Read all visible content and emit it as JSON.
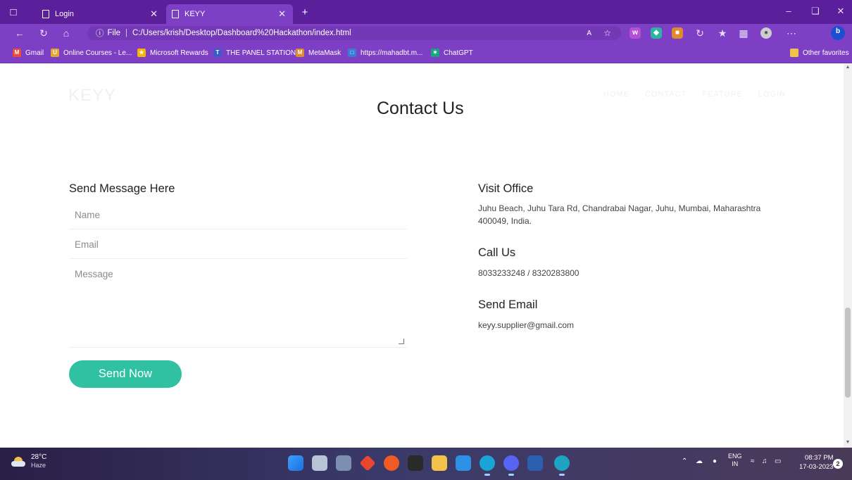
{
  "browser": {
    "tabs": [
      {
        "label": "Login"
      },
      {
        "label": "KEYY"
      }
    ],
    "new_tab_symbol": "+",
    "address": {
      "prefix": "File",
      "url": "C:/Users/krish/Desktop/Dashboard%20Hackathon/index.html"
    },
    "bookmarks": [
      {
        "label": "Gmail"
      },
      {
        "label": "Online Courses - Le..."
      },
      {
        "label": "Microsoft Rewards"
      },
      {
        "label": "THE PANEL STATION"
      },
      {
        "label": "MetaMask"
      },
      {
        "label": "https://mahadbt.m..."
      },
      {
        "label": "ChatGPT"
      }
    ],
    "other_favorites": "Other favorites",
    "accent_color": "#7d3fc4"
  },
  "page": {
    "brand": "KEYY",
    "nav": [
      "HOME",
      "CONTACT",
      "FEATURE",
      "LOGIN"
    ],
    "section_title": "Contact Us",
    "form": {
      "title": "Send Message Here",
      "name_placeholder": "Name",
      "email_placeholder": "Email",
      "message_placeholder": "Message",
      "send_label": "Send Now",
      "button_color": "#2fc1a2"
    },
    "info": {
      "office_title": "Visit Office",
      "office_address": "Juhu Beach, Juhu Tara Rd, Chandrabai Nagar, Juhu, Mumbai, Maharashtra 400049, India.",
      "call_title": "Call Us",
      "phones": "8033233248 / 8320283800",
      "email_title": "Send Email",
      "email": "keyy.supplier@gmail.com"
    }
  },
  "taskbar": {
    "temperature": "28°C",
    "weather": "Haze",
    "language": "ENG",
    "region": "IN",
    "time": "08:37 PM",
    "date": "17-03-2023",
    "notifications": "2"
  }
}
